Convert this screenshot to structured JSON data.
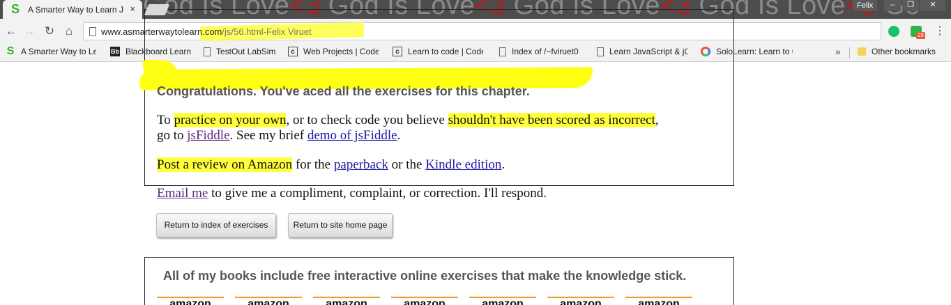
{
  "browser": {
    "tab": {
      "title": "A Smarter Way to Learn J",
      "close_glyph": "×",
      "favicon": "S"
    },
    "background_text": [
      "God Is Love",
      "<3",
      " God Is Love",
      "<3",
      " God Is Love",
      "<3",
      " God Is Love",
      "<3",
      " Go"
    ],
    "profile_name": "Felix",
    "window_buttons": {
      "minimize": "–",
      "restore": "❐",
      "close": "✕"
    },
    "nav": {
      "back": "←",
      "forward": "→",
      "reload": "↻",
      "home": "⌂"
    },
    "url": {
      "host": "www.asmarterwaytolearn.com",
      "path": "/js/56.html",
      "annotation": "-Felix Viruet"
    },
    "extension_badge": "29",
    "menu_glyph": "⋮",
    "bookmarks": [
      {
        "label": "A Smarter Way to Le",
        "icon": "smarter-way-s"
      },
      {
        "label": "Blackboard Learn",
        "icon": "Bb"
      },
      {
        "label": "TestOut LabSim",
        "icon": "page"
      },
      {
        "label": "Web Projects | Code",
        "icon": "code-c"
      },
      {
        "label": "Learn to code | Code",
        "icon": "code-c"
      },
      {
        "label": "Index of /~fviruet0",
        "icon": "page"
      },
      {
        "label": "Learn JavaScript & jQ",
        "icon": "page"
      },
      {
        "label": "SoloLearn: Learn to C",
        "icon": "sololearn"
      }
    ],
    "bookmarks_more": "»",
    "other_bookmarks": "Other bookmarks"
  },
  "page": {
    "congrats_title": "Congratulations. You've aced all the exercises for this chapter.",
    "para1": {
      "t1": "To ",
      "h1": "practice on your own",
      "t2": ", or to check code you believe ",
      "h2": "shouldn't have been scored as incorrect",
      "t3": ",",
      "t4": "go to ",
      "link1": "jsFiddle",
      "t5": ". See my brief ",
      "link2": "demo of jsFiddle",
      "t6": "."
    },
    "para2": {
      "h1": "Post a review on Amazon",
      "t1": " for the ",
      "link1": "paperback",
      "t2": " or the ",
      "link2": "Kindle edition",
      "t3": "."
    },
    "para3": {
      "link1": "Email me",
      "t1": " to give me a compliment, complaint, or correction. I'll respond."
    },
    "buttons": {
      "index": "Return to index of exercises",
      "home": "Return to site home page"
    },
    "books_title": "All of my books include free interactive online exercises that make the knowledge stick.",
    "amazon_label": "amazon"
  },
  "colors": {
    "highlighter": "#ffff3c",
    "link": "#1a1aa6",
    "visited_link": "#5e2a7e",
    "heart": "#b41d1d"
  }
}
